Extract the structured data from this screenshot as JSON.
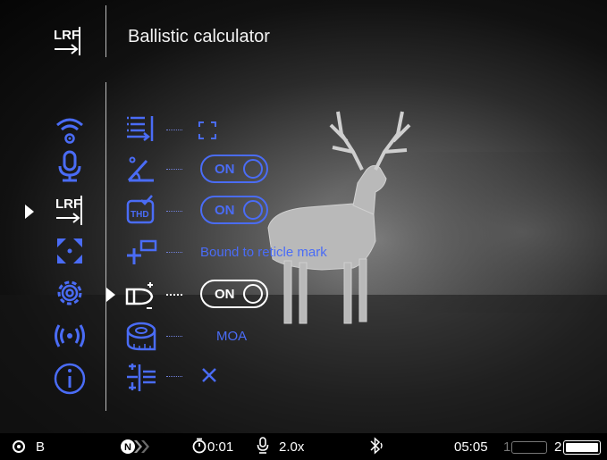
{
  "header": {
    "title": "Ballistic calculator",
    "section_icon": "lrf-icon",
    "section_label": "LRF"
  },
  "sidebar": {
    "selected": "lrf",
    "items": [
      {
        "icon": "wifi-settings-icon"
      },
      {
        "icon": "microphone-icon"
      },
      {
        "icon": "lrf-icon",
        "label": "LRF"
      },
      {
        "icon": "crosshair-move-icon"
      },
      {
        "icon": "gear-icon"
      },
      {
        "icon": "broadcast-icon"
      },
      {
        "icon": "info-icon"
      }
    ]
  },
  "menu": {
    "selected_row": 4,
    "rows": [
      {
        "icon": "display-mode-icon",
        "value_type": "icon",
        "value_icon": "frame-corners-icon"
      },
      {
        "icon": "angle-icon",
        "value_type": "toggle",
        "value": "ON"
      },
      {
        "icon": "thd-icon",
        "icon_label": "THD",
        "value_type": "toggle",
        "value": "ON"
      },
      {
        "icon": "reticle-mark-icon",
        "value_type": "text",
        "value": "Bound to reticle mark"
      },
      {
        "icon": "bullet-icon",
        "value_type": "toggle",
        "value": "ON"
      },
      {
        "icon": "tape-measure-icon",
        "value_type": "text",
        "value": "MOA"
      },
      {
        "icon": "correction-icon",
        "value_type": "icon",
        "value_icon": "close-x-icon"
      }
    ]
  },
  "statusbar": {
    "recording_icon": "record-icon",
    "profile": "B",
    "nav_icon": "nav-mode-icon",
    "nav_label": "N",
    "timer": "0:01",
    "mic_zoom": "2.0x",
    "bluetooth_icon": "bluetooth-audio-icon",
    "time": "05:05",
    "battery1_label": "1",
    "battery2_label": "2"
  },
  "colors": {
    "accent": "#4a6cf6",
    "text": "#ffffff",
    "divider": "#bdbdbd",
    "background": "#000000"
  }
}
